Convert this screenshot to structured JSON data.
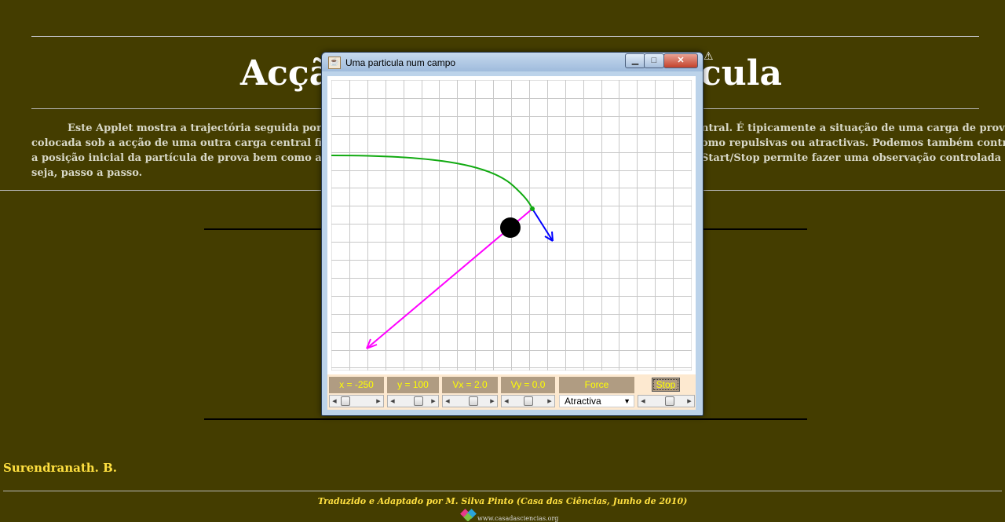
{
  "page": {
    "title_left": "Acçã",
    "title_right": "cula",
    "description_lines": [
      "Este Applet mostra a trajectória seguida por uma",
      "colocada sob a acção de uma outra carga central fixa num c",
      "a posição inicial da partícula de prova bem como a sua velo",
      "seja, passo a passo."
    ],
    "description_right_lines": [
      "ntral. É tipicamente a situação de uma carga de prova",
      "omo repulsivas ou atractivas. Podemos também controlar",
      "Start/Stop permite fazer uma observação controlada ou"
    ],
    "author": "Surendranath. B.",
    "credit": "Traduzido e Adaptado por M. Silva Pinto (Casa das Ciências, Junho de 2010)",
    "logo_text": "www.casadasciencias.org"
  },
  "window": {
    "title": "Uma particula num campo",
    "icon": "java-cup-icon",
    "buttons": {
      "minimize": "minimize-icon",
      "maximize": "maximize-icon",
      "close": "close-icon"
    }
  },
  "simulation": {
    "background": "#ffffff",
    "grid_color": "#c8c8c8",
    "path_color": "#11aa11",
    "force_color": "#ff00ff",
    "velocity_color": "#0000ff",
    "charge_color": "#000000"
  },
  "controls": {
    "x_label": "x = -250",
    "y_label": "y = 100",
    "vx_label": "Vx = 2.0",
    "vy_label": "Vy = 0.0",
    "force_label": "Force",
    "stop_label": "Stop",
    "force_type_selected": "Atractiva",
    "slider_positions": {
      "x": 0.0,
      "y": 0.5,
      "vx": 0.6,
      "vy": 0.5,
      "speed": 0.6
    }
  }
}
